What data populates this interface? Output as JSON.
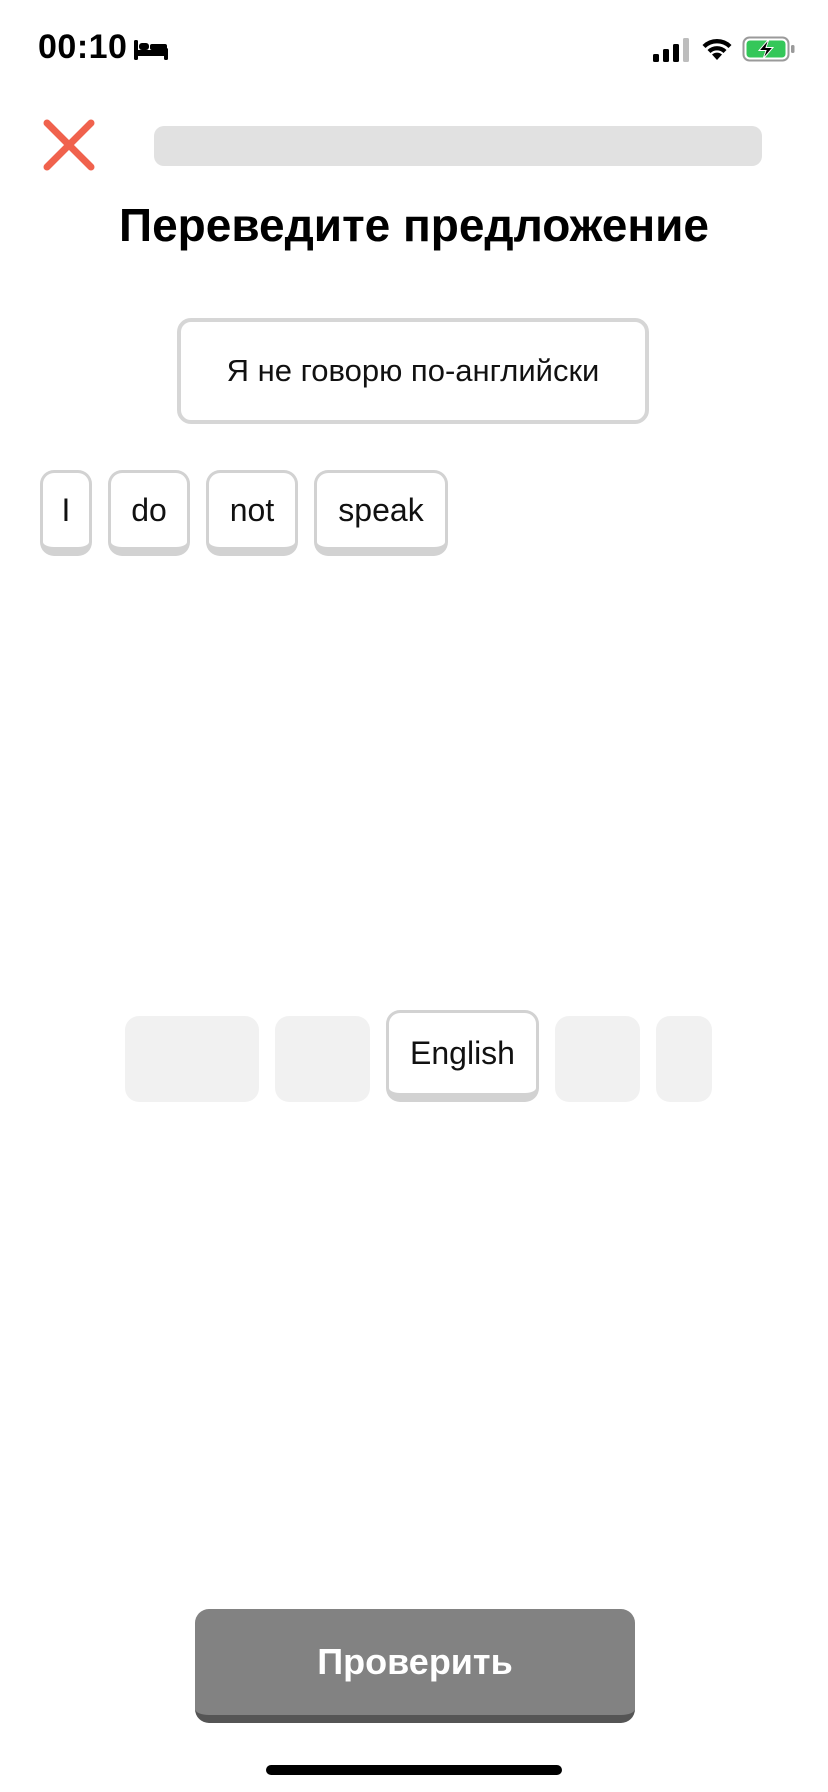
{
  "status_bar": {
    "time": "00:10",
    "icons": [
      "sleep-mode-icon",
      "cellular-signal-icon",
      "wifi-icon",
      "battery-charging-icon"
    ],
    "battery_color": "#34c759"
  },
  "header": {
    "close_icon": "close-icon",
    "close_color": "#f0624d",
    "progress": 0,
    "progress_track_color": "#e1e1e1"
  },
  "exercise": {
    "title": "Переведите предложение",
    "prompt": "Я не говорю по-английски"
  },
  "answer": {
    "words": [
      "I",
      "do",
      "not",
      "speak"
    ]
  },
  "word_bank": {
    "visible_words": [
      "English"
    ],
    "slot_count": 5
  },
  "footer": {
    "check_label": "Проверить",
    "check_color": "#828282"
  }
}
